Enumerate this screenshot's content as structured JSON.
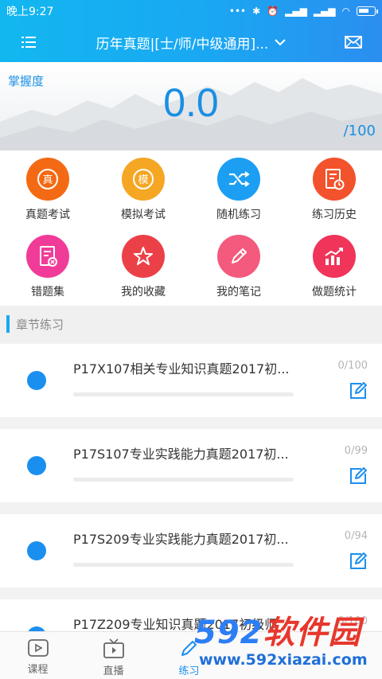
{
  "status": {
    "time": "晚上9:27"
  },
  "header": {
    "title": "历年真题|[士/师/中级通用]..."
  },
  "mastery": {
    "label": "掌握度",
    "score": "0.0",
    "total": "/100"
  },
  "grid": [
    {
      "label": "真题考试",
      "icon": "zhen-icon",
      "color": "#f46a14",
      "glyph": "真"
    },
    {
      "label": "模拟考试",
      "icon": "mo-icon",
      "color": "#f5a623",
      "glyph": "模"
    },
    {
      "label": "随机练习",
      "icon": "shuffle-icon",
      "color": "#1c9ef2",
      "glyph": "⤮"
    },
    {
      "label": "练习历史",
      "icon": "history-icon",
      "color": "#f2522c",
      "glyph": ""
    },
    {
      "label": "错题集",
      "icon": "wrong-book-icon",
      "color": "#f03c98",
      "glyph": ""
    },
    {
      "label": "我的收藏",
      "icon": "star-icon",
      "color": "#ec4049",
      "glyph": "☆"
    },
    {
      "label": "我的笔记",
      "icon": "pencil-icon",
      "color": "#f35a7e",
      "glyph": "✎"
    },
    {
      "label": "做题统计",
      "icon": "stats-icon",
      "color": "#f0345a",
      "glyph": ""
    }
  ],
  "section": {
    "title": "章节练习"
  },
  "chapters": [
    {
      "title": "P17X107相关专业知识真题2017初...",
      "count": "0/100",
      "progress": 0
    },
    {
      "title": "P17S107专业实践能力真题2017初...",
      "count": "0/99",
      "progress": 0
    },
    {
      "title": "P17S209专业实践能力真题2017初...",
      "count": "0/94",
      "progress": 0
    },
    {
      "title": "P17Z209专业知识真题2017初级师",
      "count": "0/100",
      "progress": 0
    }
  ],
  "nav": [
    {
      "label": "课程",
      "icon": "course-icon"
    },
    {
      "label": "直播",
      "icon": "tv-icon"
    },
    {
      "label": "练习",
      "icon": "practice-icon",
      "active": true
    }
  ],
  "watermark": {
    "num": "592",
    "cn": "软件园",
    "url": "www.592xiazai.com"
  }
}
